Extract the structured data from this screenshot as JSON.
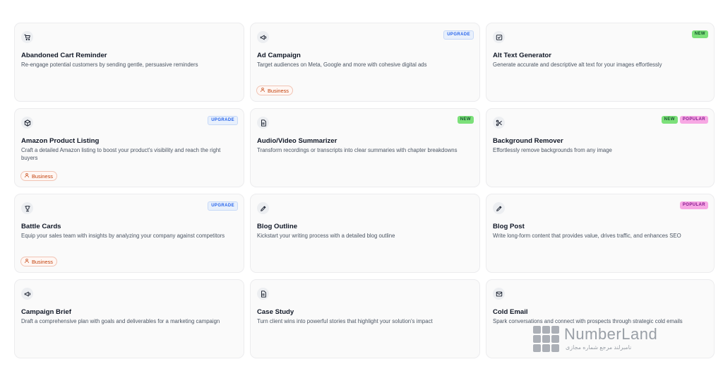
{
  "cards": [
    {
      "icon": "shopping-cart-icon",
      "title": "Abandoned Cart Reminder",
      "description": "Re-engage potential customers by sending gentle, persuasive reminders",
      "badges": [],
      "plan": ""
    },
    {
      "icon": "megaphone-icon",
      "title": "Ad Campaign",
      "description": "Target audiences on Meta, Google and more with cohesive digital ads",
      "badges": [
        "UPGRADE"
      ],
      "plan": "Business"
    },
    {
      "icon": "image-text-icon",
      "title": "Alt Text Generator",
      "description": "Generate accurate and descriptive alt text for your images effortlessly",
      "badges": [
        "NEW"
      ],
      "plan": ""
    },
    {
      "icon": "package-icon",
      "title": "Amazon Product Listing",
      "description": "Craft a detailed Amazon listing to boost your product's visibility and reach the right buyers",
      "badges": [
        "UPGRADE"
      ],
      "plan": "Business"
    },
    {
      "icon": "document-icon",
      "title": "Audio/Video Summarizer",
      "description": "Transform recordings or transcripts into clear summaries with chapter breakdowns",
      "badges": [
        "NEW"
      ],
      "plan": ""
    },
    {
      "icon": "scissors-icon",
      "title": "Background Remover",
      "description": "Effortlessly remove backgrounds from any image",
      "badges": [
        "NEW",
        "POPULAR"
      ],
      "plan": ""
    },
    {
      "icon": "trophy-icon",
      "title": "Battle Cards",
      "description": "Equip your sales team with insights by analyzing your company against competitors",
      "badges": [
        "UPGRADE"
      ],
      "plan": "Business"
    },
    {
      "icon": "pen-icon",
      "title": "Blog Outline",
      "description": "Kickstart your writing process with a detailed blog outline",
      "badges": [],
      "plan": ""
    },
    {
      "icon": "pen-icon",
      "title": "Blog Post",
      "description": "Write long-form content that provides value, drives traffic, and enhances SEO",
      "badges": [
        "POPULAR"
      ],
      "plan": ""
    },
    {
      "icon": "megaphone-icon",
      "title": "Campaign Brief",
      "description": "Draft a comprehensive plan with goals and deliverables for a marketing campaign",
      "badges": [],
      "plan": ""
    },
    {
      "icon": "document-icon",
      "title": "Case Study",
      "description": "Turn client wins into powerful stories that highlight your solution's impact",
      "badges": [],
      "plan": ""
    },
    {
      "icon": "mail-icon",
      "title": "Cold Email",
      "description": "Spark conversations and connect with prospects through strategic cold emails",
      "badges": [],
      "plan": ""
    }
  ],
  "watermark": {
    "name": "NumberLand",
    "subtitle": "نامبرلند مرجع شماره مجازی"
  }
}
